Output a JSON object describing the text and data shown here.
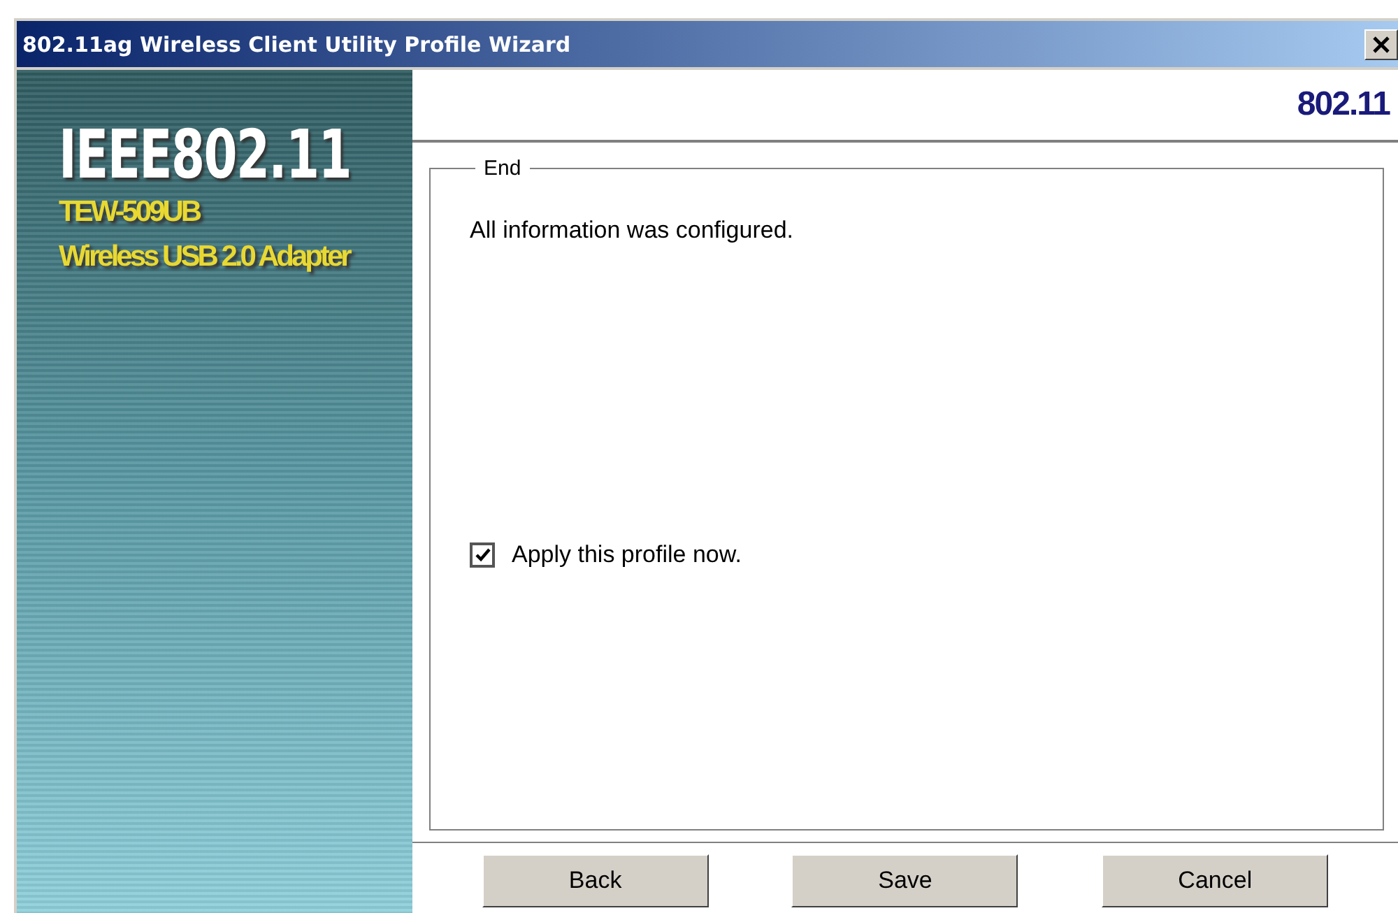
{
  "window": {
    "title": "802.11ag Wireless Client Utility Profile Wizard"
  },
  "banner": {
    "logo": "IEEE802.11",
    "model": "TEW-509UB",
    "product": "Wireless USB 2.0 Adapter"
  },
  "header": {
    "brand": "802.11"
  },
  "group": {
    "title": "End",
    "message": "All information was configured."
  },
  "checkbox": {
    "label": "Apply this profile now.",
    "checked": true
  },
  "buttons": [
    {
      "label": "Back"
    },
    {
      "label": "Save"
    },
    {
      "label": "Cancel"
    }
  ]
}
